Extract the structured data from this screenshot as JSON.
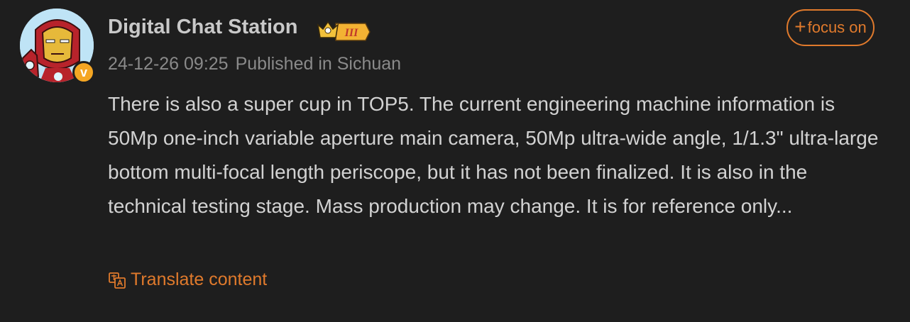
{
  "user": {
    "name": "Digital Chat Station",
    "rank_badge": "III",
    "verified_mark": "v"
  },
  "post": {
    "date": "24-12-26 09:25",
    "location": "Published in Sichuan",
    "content": "There is also a super cup in TOP5. The current engineering machine information is 50Mp one-inch variable aperture main camera, 50Mp ultra-wide angle, 1/1.3\" ultra-large bottom multi-focal length periscope, but it has not been finalized. It is also in the technical testing stage. Mass production may change. It is for reference only..."
  },
  "actions": {
    "focus_icon": "+",
    "focus_label": "focus on",
    "translate_label": "Translate content"
  },
  "colors": {
    "background": "#1e1e1e",
    "accent": "#e07a2c",
    "verified": "#f5a623"
  },
  "icons": [
    "avatar-ironman",
    "crown-icon",
    "translate-icon",
    "plus-icon"
  ]
}
